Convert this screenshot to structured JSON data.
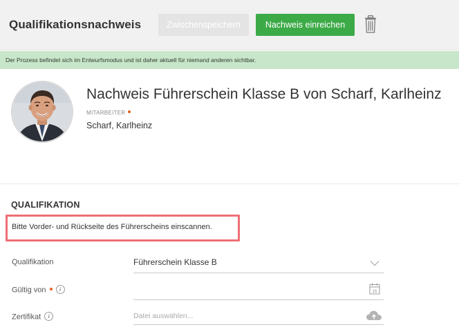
{
  "header": {
    "title": "Qualifikationsnachweis",
    "save_label": "Zwischenspeichern",
    "submit_label": "Nachweis einreichen",
    "delete_icon": "trash-icon"
  },
  "banner": {
    "text": "Der Prozess befindet sich im Entwurfsmodus und ist daher aktuell für niemand anderen sichtbar."
  },
  "profile": {
    "title": "Nachweis Führerschein Klasse B von Scharf, Karlheinz",
    "employee_label": "MITARBEITER",
    "employee_name": "Scharf, Karlheinz"
  },
  "section": {
    "title": "QUALIFIKATION",
    "instruction": "Bitte Vorder- und Rückseite des Führerscheins einscannen."
  },
  "fields": {
    "qualification": {
      "label": "Qualifikation",
      "value": "Führerschein Klasse B",
      "icon": "chevron-down-icon"
    },
    "valid_from": {
      "label": "Gültig von",
      "value": "",
      "info": "i",
      "icon": "calendar-icon",
      "calendar_day": "15"
    },
    "certificate": {
      "label": "Zertifikat",
      "placeholder": "Datei auswählen...",
      "info": "i",
      "icon": "cloud-upload-icon"
    }
  },
  "colors": {
    "primary": "#3daa48",
    "banner_bg": "#c8e6c9",
    "highlight": "#ee6f74",
    "required": "#e8601c"
  }
}
